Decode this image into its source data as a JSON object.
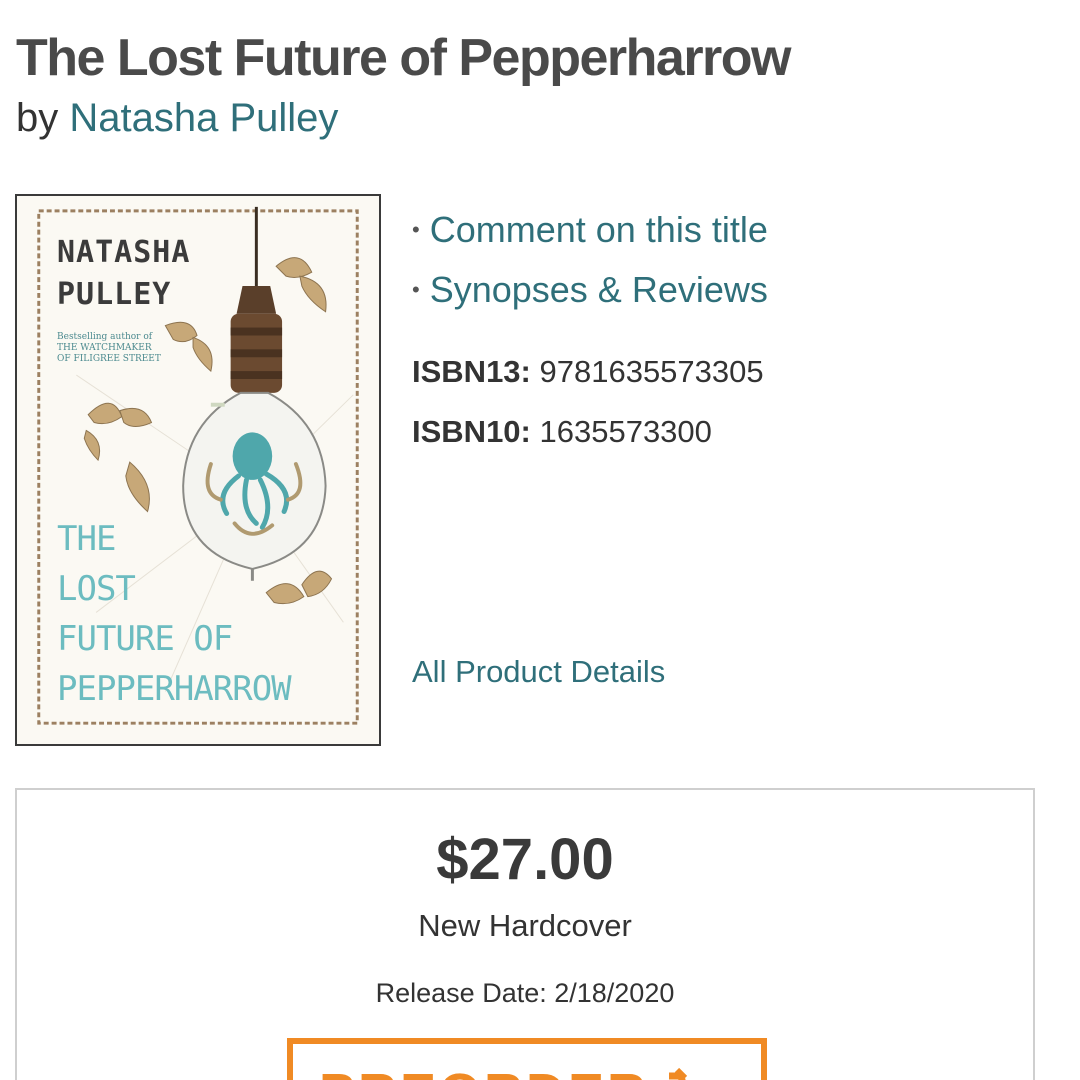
{
  "book": {
    "title": "The Lost Future of Pepperharrow",
    "by_label": "by",
    "author": "Natasha Pulley"
  },
  "cover": {
    "author_line1": "NATASHA",
    "author_line2": "PULLEY",
    "tagline_line1": "Bestselling author of",
    "tagline_line2": "THE WATCHMAKER",
    "tagline_line3": "OF FILIGREE STREET",
    "title_line1": "THE",
    "title_line2": "LOST",
    "title_line3": "FUTURE OF",
    "title_line4": "PEPPERHARROW"
  },
  "links": {
    "comment": "Comment on this title",
    "synopses": "Synopses & Reviews"
  },
  "isbn": {
    "isbn13_label": "ISBN13:",
    "isbn13_value": "9781635573305",
    "isbn10_label": "ISBN10:",
    "isbn10_value": "1635573300"
  },
  "details_link": "All Product Details",
  "purchase": {
    "price": "$27.00",
    "format": "New Hardcover",
    "release_date": "Release Date: 2/18/2020",
    "button_label": "PREORDER"
  },
  "colors": {
    "link": "#2f6f7a",
    "accent": "#f08a24",
    "cover_title": "#6cbcc0"
  },
  "icons": [
    "cart-icon",
    "bullet-icon"
  ]
}
